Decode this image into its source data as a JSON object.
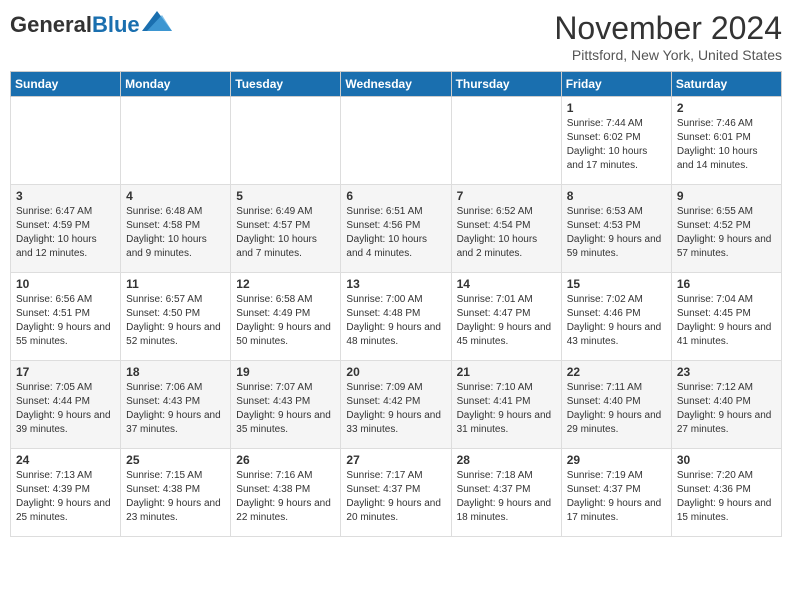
{
  "logo": {
    "general": "General",
    "blue": "Blue"
  },
  "title": "November 2024",
  "location": "Pittsford, New York, United States",
  "days_of_week": [
    "Sunday",
    "Monday",
    "Tuesday",
    "Wednesday",
    "Thursday",
    "Friday",
    "Saturday"
  ],
  "weeks": [
    [
      {
        "day": "",
        "sunrise": "",
        "sunset": "",
        "daylight": ""
      },
      {
        "day": "",
        "sunrise": "",
        "sunset": "",
        "daylight": ""
      },
      {
        "day": "",
        "sunrise": "",
        "sunset": "",
        "daylight": ""
      },
      {
        "day": "",
        "sunrise": "",
        "sunset": "",
        "daylight": ""
      },
      {
        "day": "",
        "sunrise": "",
        "sunset": "",
        "daylight": ""
      },
      {
        "day": "1",
        "sunrise": "Sunrise: 7:44 AM",
        "sunset": "Sunset: 6:02 PM",
        "daylight": "Daylight: 10 hours and 17 minutes."
      },
      {
        "day": "2",
        "sunrise": "Sunrise: 7:46 AM",
        "sunset": "Sunset: 6:01 PM",
        "daylight": "Daylight: 10 hours and 14 minutes."
      }
    ],
    [
      {
        "day": "3",
        "sunrise": "Sunrise: 6:47 AM",
        "sunset": "Sunset: 4:59 PM",
        "daylight": "Daylight: 10 hours and 12 minutes."
      },
      {
        "day": "4",
        "sunrise": "Sunrise: 6:48 AM",
        "sunset": "Sunset: 4:58 PM",
        "daylight": "Daylight: 10 hours and 9 minutes."
      },
      {
        "day": "5",
        "sunrise": "Sunrise: 6:49 AM",
        "sunset": "Sunset: 4:57 PM",
        "daylight": "Daylight: 10 hours and 7 minutes."
      },
      {
        "day": "6",
        "sunrise": "Sunrise: 6:51 AM",
        "sunset": "Sunset: 4:56 PM",
        "daylight": "Daylight: 10 hours and 4 minutes."
      },
      {
        "day": "7",
        "sunrise": "Sunrise: 6:52 AM",
        "sunset": "Sunset: 4:54 PM",
        "daylight": "Daylight: 10 hours and 2 minutes."
      },
      {
        "day": "8",
        "sunrise": "Sunrise: 6:53 AM",
        "sunset": "Sunset: 4:53 PM",
        "daylight": "Daylight: 9 hours and 59 minutes."
      },
      {
        "day": "9",
        "sunrise": "Sunrise: 6:55 AM",
        "sunset": "Sunset: 4:52 PM",
        "daylight": "Daylight: 9 hours and 57 minutes."
      }
    ],
    [
      {
        "day": "10",
        "sunrise": "Sunrise: 6:56 AM",
        "sunset": "Sunset: 4:51 PM",
        "daylight": "Daylight: 9 hours and 55 minutes."
      },
      {
        "day": "11",
        "sunrise": "Sunrise: 6:57 AM",
        "sunset": "Sunset: 4:50 PM",
        "daylight": "Daylight: 9 hours and 52 minutes."
      },
      {
        "day": "12",
        "sunrise": "Sunrise: 6:58 AM",
        "sunset": "Sunset: 4:49 PM",
        "daylight": "Daylight: 9 hours and 50 minutes."
      },
      {
        "day": "13",
        "sunrise": "Sunrise: 7:00 AM",
        "sunset": "Sunset: 4:48 PM",
        "daylight": "Daylight: 9 hours and 48 minutes."
      },
      {
        "day": "14",
        "sunrise": "Sunrise: 7:01 AM",
        "sunset": "Sunset: 4:47 PM",
        "daylight": "Daylight: 9 hours and 45 minutes."
      },
      {
        "day": "15",
        "sunrise": "Sunrise: 7:02 AM",
        "sunset": "Sunset: 4:46 PM",
        "daylight": "Daylight: 9 hours and 43 minutes."
      },
      {
        "day": "16",
        "sunrise": "Sunrise: 7:04 AM",
        "sunset": "Sunset: 4:45 PM",
        "daylight": "Daylight: 9 hours and 41 minutes."
      }
    ],
    [
      {
        "day": "17",
        "sunrise": "Sunrise: 7:05 AM",
        "sunset": "Sunset: 4:44 PM",
        "daylight": "Daylight: 9 hours and 39 minutes."
      },
      {
        "day": "18",
        "sunrise": "Sunrise: 7:06 AM",
        "sunset": "Sunset: 4:43 PM",
        "daylight": "Daylight: 9 hours and 37 minutes."
      },
      {
        "day": "19",
        "sunrise": "Sunrise: 7:07 AM",
        "sunset": "Sunset: 4:43 PM",
        "daylight": "Daylight: 9 hours and 35 minutes."
      },
      {
        "day": "20",
        "sunrise": "Sunrise: 7:09 AM",
        "sunset": "Sunset: 4:42 PM",
        "daylight": "Daylight: 9 hours and 33 minutes."
      },
      {
        "day": "21",
        "sunrise": "Sunrise: 7:10 AM",
        "sunset": "Sunset: 4:41 PM",
        "daylight": "Daylight: 9 hours and 31 minutes."
      },
      {
        "day": "22",
        "sunrise": "Sunrise: 7:11 AM",
        "sunset": "Sunset: 4:40 PM",
        "daylight": "Daylight: 9 hours and 29 minutes."
      },
      {
        "day": "23",
        "sunrise": "Sunrise: 7:12 AM",
        "sunset": "Sunset: 4:40 PM",
        "daylight": "Daylight: 9 hours and 27 minutes."
      }
    ],
    [
      {
        "day": "24",
        "sunrise": "Sunrise: 7:13 AM",
        "sunset": "Sunset: 4:39 PM",
        "daylight": "Daylight: 9 hours and 25 minutes."
      },
      {
        "day": "25",
        "sunrise": "Sunrise: 7:15 AM",
        "sunset": "Sunset: 4:38 PM",
        "daylight": "Daylight: 9 hours and 23 minutes."
      },
      {
        "day": "26",
        "sunrise": "Sunrise: 7:16 AM",
        "sunset": "Sunset: 4:38 PM",
        "daylight": "Daylight: 9 hours and 22 minutes."
      },
      {
        "day": "27",
        "sunrise": "Sunrise: 7:17 AM",
        "sunset": "Sunset: 4:37 PM",
        "daylight": "Daylight: 9 hours and 20 minutes."
      },
      {
        "day": "28",
        "sunrise": "Sunrise: 7:18 AM",
        "sunset": "Sunset: 4:37 PM",
        "daylight": "Daylight: 9 hours and 18 minutes."
      },
      {
        "day": "29",
        "sunrise": "Sunrise: 7:19 AM",
        "sunset": "Sunset: 4:37 PM",
        "daylight": "Daylight: 9 hours and 17 minutes."
      },
      {
        "day": "30",
        "sunrise": "Sunrise: 7:20 AM",
        "sunset": "Sunset: 4:36 PM",
        "daylight": "Daylight: 9 hours and 15 minutes."
      }
    ]
  ]
}
